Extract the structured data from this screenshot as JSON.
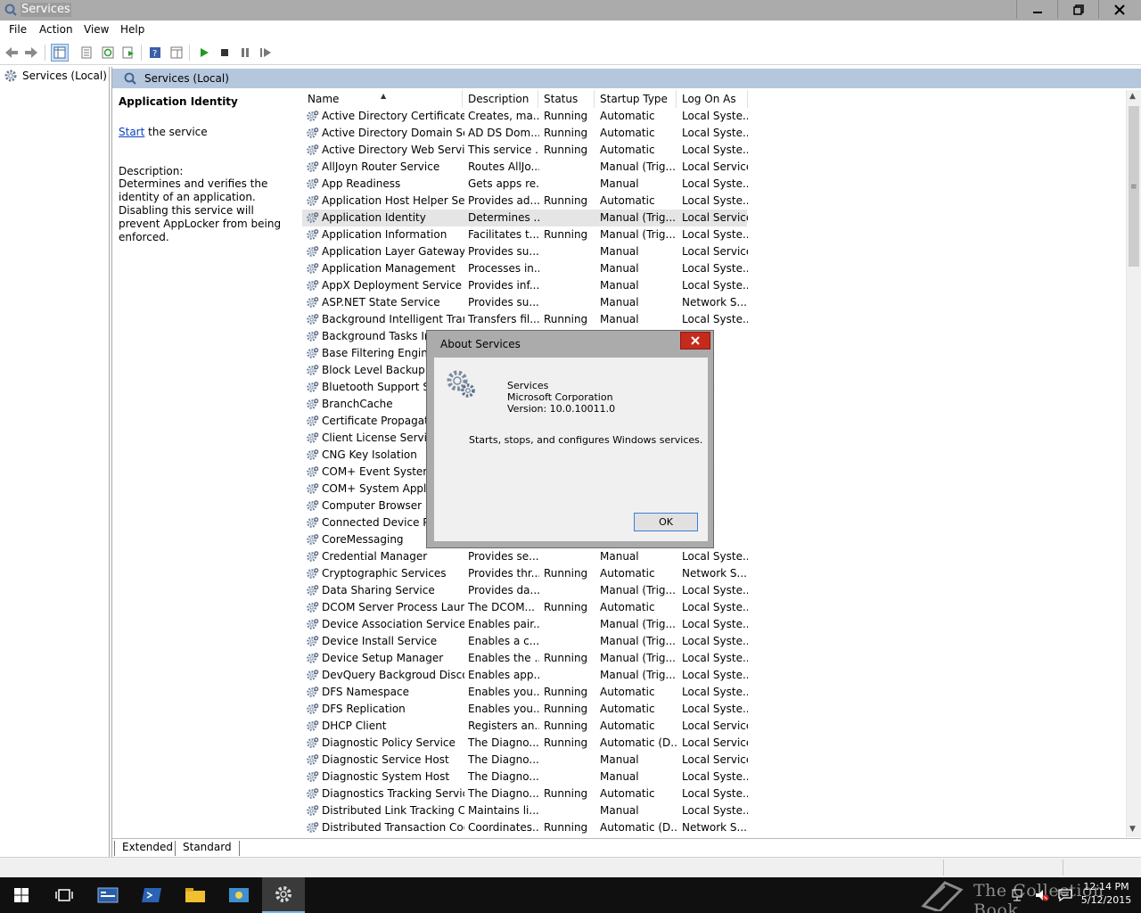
{
  "window": {
    "title": "Services"
  },
  "menu": [
    "File",
    "Action",
    "View",
    "Help"
  ],
  "tree": {
    "root": "Services (Local)"
  },
  "main": {
    "header": "Services (Local)"
  },
  "detail": {
    "service_name": "Application Identity",
    "start_link": "Start",
    "start_suffix": " the service",
    "description_label": "Description:",
    "description": "Determines and verifies the identity of an application. Disabling this service will prevent AppLocker from being enforced."
  },
  "columns": [
    "Name",
    "Description",
    "Status",
    "Startup Type",
    "Log On As"
  ],
  "services": [
    [
      "Active Directory Certificate ...",
      "Creates, ma...",
      "Running",
      "Automatic",
      "Local Syste..."
    ],
    [
      "Active Directory Domain Se...",
      "AD DS Dom...",
      "Running",
      "Automatic",
      "Local Syste..."
    ],
    [
      "Active Directory Web Services",
      "This service ...",
      "Running",
      "Automatic",
      "Local Syste..."
    ],
    [
      "AllJoyn Router Service",
      "Routes AllJo...",
      "",
      "Manual (Trig...",
      "Local Service"
    ],
    [
      "App Readiness",
      "Gets apps re...",
      "",
      "Manual",
      "Local Syste..."
    ],
    [
      "Application Host Helper Ser...",
      "Provides ad...",
      "Running",
      "Automatic",
      "Local Syste..."
    ],
    [
      "Application Identity",
      "Determines ...",
      "",
      "Manual (Trig...",
      "Local Service"
    ],
    [
      "Application Information",
      "Facilitates t...",
      "Running",
      "Manual (Trig...",
      "Local Syste..."
    ],
    [
      "Application Layer Gateway ...",
      "Provides su...",
      "",
      "Manual",
      "Local Service"
    ],
    [
      "Application Management",
      "Processes in...",
      "",
      "Manual",
      "Local Syste..."
    ],
    [
      "AppX Deployment Service (...",
      "Provides inf...",
      "",
      "Manual",
      "Local Syste..."
    ],
    [
      "ASP.NET State Service",
      "Provides su...",
      "",
      "Manual",
      "Network S..."
    ],
    [
      "Background Intelligent Tran...",
      "Transfers fil...",
      "Running",
      "Manual",
      "Local Syste..."
    ],
    [
      "Background Tasks Infr",
      "",
      "",
      "",
      "yste..."
    ],
    [
      "Base Filtering Engine",
      "",
      "",
      "",
      "ervice"
    ],
    [
      "Block Level Backup En",
      "",
      "",
      "",
      "yste..."
    ],
    [
      "Bluetooth Support Ser",
      "",
      "",
      "",
      "ervice"
    ],
    [
      "BranchCache",
      "",
      "",
      "",
      "k S..."
    ],
    [
      "Certificate Propagation",
      "",
      "",
      "",
      "yste..."
    ],
    [
      "Client License Service",
      "",
      "",
      "",
      "yste..."
    ],
    [
      "CNG Key Isolation",
      "",
      "",
      "",
      "yste..."
    ],
    [
      "COM+ Event System",
      "",
      "",
      "",
      "ervice"
    ],
    [
      "COM+ System Applica",
      "",
      "",
      "",
      "yste..."
    ],
    [
      "Computer Browser",
      "",
      "",
      "",
      "yste..."
    ],
    [
      "Connected Device Plat",
      "",
      "",
      "",
      "ervice"
    ],
    [
      "CoreMessaging",
      "",
      "",
      "",
      "k S..."
    ],
    [
      "Credential Manager",
      "Provides se...",
      "",
      "Manual",
      "Local Syste..."
    ],
    [
      "Cryptographic Services",
      "Provides thr...",
      "Running",
      "Automatic",
      "Network S..."
    ],
    [
      "Data Sharing Service",
      "Provides da...",
      "",
      "Manual (Trig...",
      "Local Syste..."
    ],
    [
      "DCOM Server Process Laun...",
      "The DCOM...",
      "Running",
      "Automatic",
      "Local Syste..."
    ],
    [
      "Device Association Service",
      "Enables pair...",
      "",
      "Manual (Trig...",
      "Local Syste..."
    ],
    [
      "Device Install Service",
      "Enables a c...",
      "",
      "Manual (Trig...",
      "Local Syste..."
    ],
    [
      "Device Setup Manager",
      "Enables the ...",
      "Running",
      "Manual (Trig...",
      "Local Syste..."
    ],
    [
      "DevQuery Backgroud Disco...",
      "Enables app...",
      "",
      "Manual (Trig...",
      "Local Syste..."
    ],
    [
      "DFS Namespace",
      "Enables you...",
      "Running",
      "Automatic",
      "Local Syste..."
    ],
    [
      "DFS Replication",
      "Enables you...",
      "Running",
      "Automatic",
      "Local Syste..."
    ],
    [
      "DHCP Client",
      "Registers an...",
      "Running",
      "Automatic",
      "Local Service"
    ],
    [
      "Diagnostic Policy Service",
      "The Diagno...",
      "Running",
      "Automatic (D...",
      "Local Service"
    ],
    [
      "Diagnostic Service Host",
      "The Diagno...",
      "",
      "Manual",
      "Local Service"
    ],
    [
      "Diagnostic System Host",
      "The Diagno...",
      "",
      "Manual",
      "Local Syste..."
    ],
    [
      "Diagnostics Tracking Service",
      "The Diagno...",
      "Running",
      "Automatic",
      "Local Syste..."
    ],
    [
      "Distributed Link Tracking Cl...",
      "Maintains li...",
      "",
      "Manual",
      "Local Syste..."
    ],
    [
      "Distributed Transaction Coo...",
      "Coordinates...",
      "Running",
      "Automatic (D...",
      "Network S..."
    ]
  ],
  "selected_row": 6,
  "tabs": [
    "Extended",
    "Standard"
  ],
  "dialog": {
    "title": "About Services",
    "product": "Services",
    "company": "Microsoft Corporation",
    "version": "Version: 10.0.10011.0",
    "summary": "Starts, stops, and configures Windows services.",
    "ok_label": "OK"
  },
  "taskbar": {
    "time": "12:14 PM",
    "date": "5/12/2015",
    "watermark": "The Collection Book"
  },
  "colors": {
    "header_bg": "#b5c7dd",
    "titlebar_bg": "#ababab",
    "close_red": "#c42b1c",
    "link_blue": "#0b41c1",
    "taskbar_bg": "#101010"
  }
}
